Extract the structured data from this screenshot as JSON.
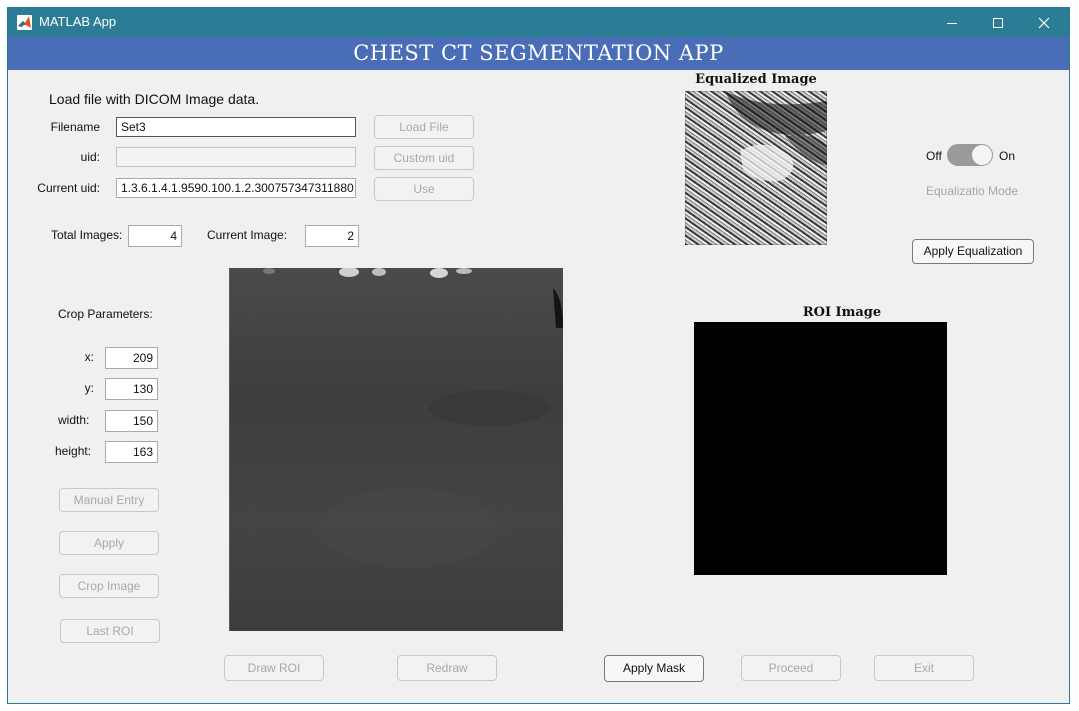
{
  "window": {
    "title": "MATLAB App"
  },
  "banner": {
    "title": "CHEST CT SEGMENTATION APP"
  },
  "load": {
    "heading": "Load file with DICOM Image data.",
    "filename_label": "Filename",
    "filename_value": "Set3",
    "uid_label": "uid:",
    "uid_value": "",
    "current_uid_label": "Current uid:",
    "current_uid_value": "1.3.6.1.4.1.9590.100.1.2.300757347311880",
    "load_file_button": "Load File",
    "custom_uid_button": "Custom uid",
    "use_button": "Use"
  },
  "counts": {
    "total_label": "Total Images:",
    "total_value": "4",
    "current_label": "Current Image:",
    "current_value": "2"
  },
  "crop": {
    "heading": "Crop Parameters:",
    "x_label": "x:",
    "x_value": "209",
    "y_label": "y:",
    "y_value": "130",
    "width_label": "width:",
    "width_value": "150",
    "height_label": "height:",
    "height_value": "163",
    "manual_entry_button": "Manual Entry",
    "apply_button": "Apply",
    "crop_image_button": "Crop Image",
    "last_roi_button": "Last ROI"
  },
  "equalization": {
    "image_title": "Equalized Image",
    "toggle_off": "Off",
    "toggle_on": "On",
    "toggle_state": "On",
    "mode_label": "Equalizatio Mode",
    "apply_button": "Apply Equalization"
  },
  "roi": {
    "image_title": "ROI Image"
  },
  "bottom": {
    "draw_roi_button": "Draw ROI",
    "redraw_button": "Redraw",
    "apply_mask_button": "Apply Mask",
    "proceed_button": "Proceed",
    "exit_button": "Exit"
  },
  "colors": {
    "titlebar": "#2b7d95",
    "banner": "#4a6db8",
    "window_bg": "#f0f0f0"
  }
}
